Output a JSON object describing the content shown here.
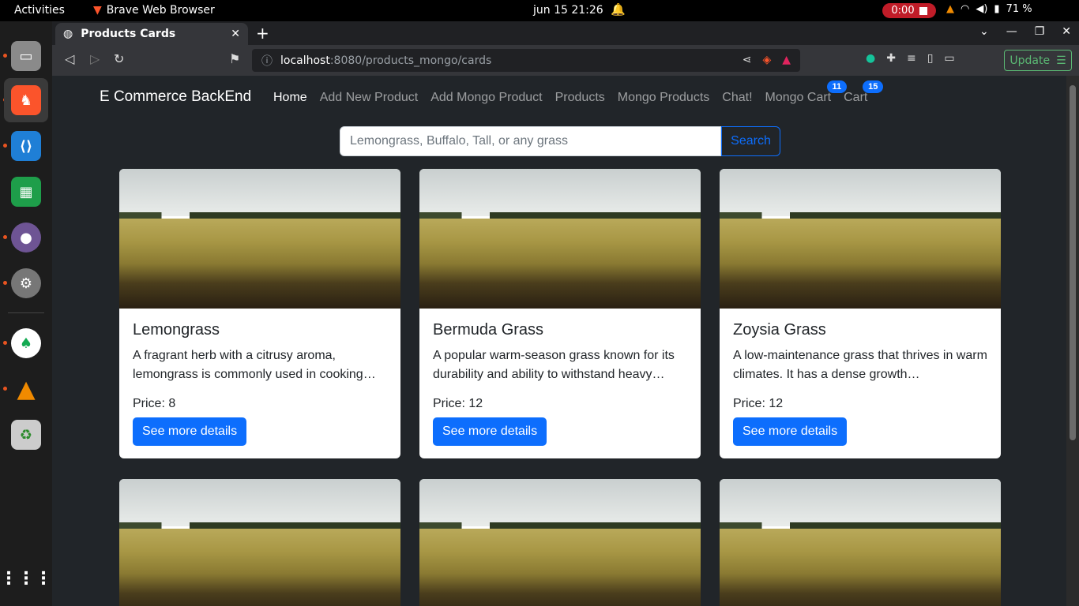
{
  "system": {
    "activities": "Activities",
    "app_name": "Brave Web Browser",
    "clock": "jun 15  21:26",
    "recording": "0:00",
    "battery": "71 %"
  },
  "browser": {
    "tab_title": "Products Cards",
    "url_host": "localhost",
    "url_rest": ":8080/products_mongo/cards",
    "update_label": "Update"
  },
  "navbar": {
    "brand": "E Commerce BackEnd",
    "links": [
      "Home",
      "Add New Product",
      "Add Mongo Product",
      "Products",
      "Mongo Products",
      "Chat!",
      "Mongo Cart",
      "Cart"
    ],
    "mongo_cart_count": "11",
    "cart_count": "15"
  },
  "search": {
    "placeholder": "Lemongrass, Buffalo, Tall, or any grass",
    "button": "Search"
  },
  "cards": [
    {
      "title": "Lemongrass",
      "desc": "A fragrant herb with a citrusy aroma, lemongrass is commonly used in cooking…",
      "price": "Price: 8",
      "button": "See more details"
    },
    {
      "title": "Bermuda Grass",
      "desc": "A popular warm-season grass known for its durability and ability to withstand heavy…",
      "price": "Price: 12",
      "button": "See more details"
    },
    {
      "title": "Zoysia Grass",
      "desc": "A low-maintenance grass that thrives in warm climates. It has a dense growth…",
      "price": "Price: 12",
      "button": "See more details"
    }
  ],
  "colors": {
    "primary": "#0d6efd",
    "page_bg": "#212529"
  }
}
